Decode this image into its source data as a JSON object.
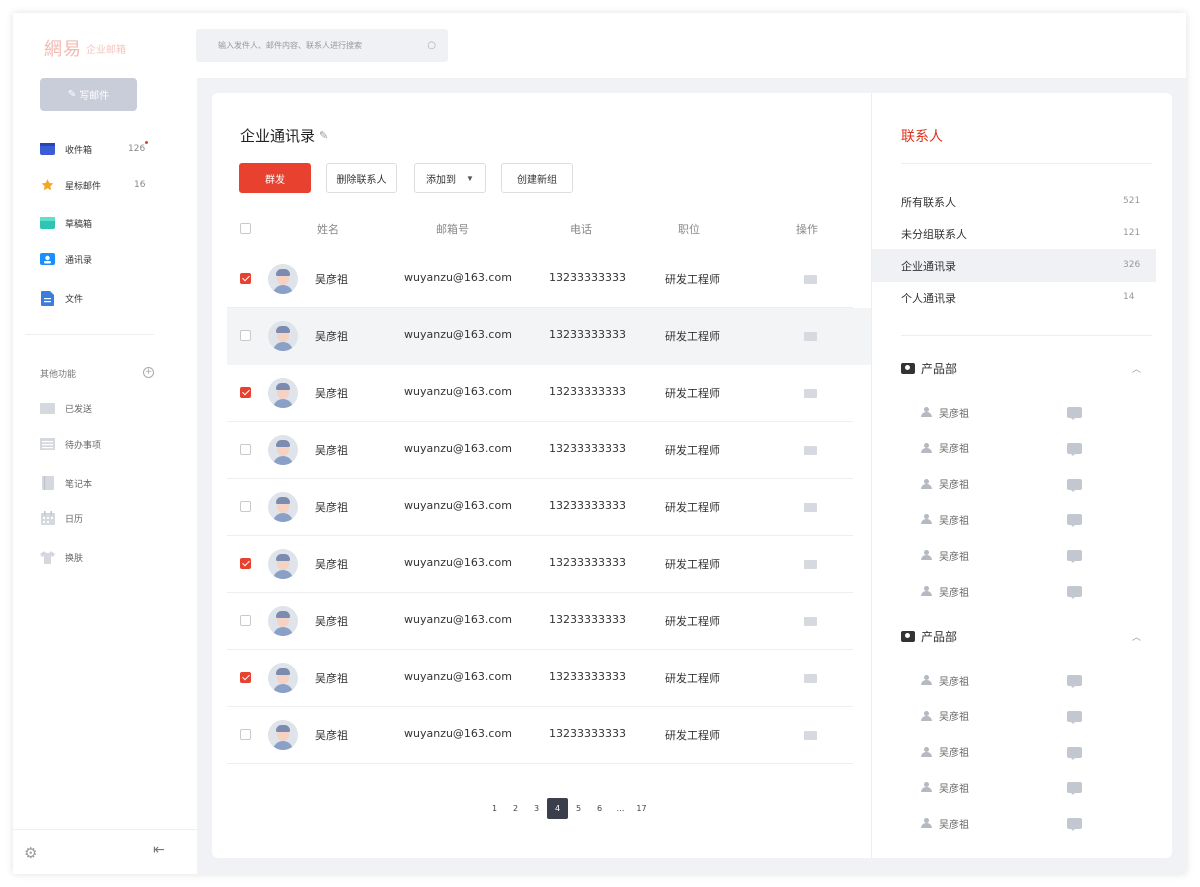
{
  "sidebar": {
    "logo_mark": "網易",
    "logo_text": "企业邮箱",
    "compose_label": "写邮件",
    "nav": [
      {
        "label": "收件箱",
        "count": "126",
        "icon": "inbox-icon",
        "color": "#3b5cd6"
      },
      {
        "label": "星标邮件",
        "count": "16",
        "icon": "star-icon",
        "color": "#f5a623"
      },
      {
        "label": "草稿箱",
        "count": "",
        "icon": "draft-icon",
        "color": "#2ec4b6"
      },
      {
        "label": "通讯录",
        "count": "",
        "icon": "contacts-icon",
        "color": "#1890ff"
      },
      {
        "label": "文件",
        "count": "",
        "icon": "file-icon",
        "color": "#3b7ddd"
      }
    ],
    "other_heading": "其他功能",
    "other": [
      {
        "label": "已发送",
        "icon": "sent-icon"
      },
      {
        "label": "待办事项",
        "icon": "todo-icon"
      },
      {
        "label": "笔记本",
        "icon": "notebook-icon"
      },
      {
        "label": "日历",
        "icon": "calendar-icon"
      },
      {
        "label": "换肤",
        "icon": "skin-icon"
      }
    ]
  },
  "search": {
    "placeholder": "输入发件人、邮件内容、联系人进行搜索"
  },
  "main": {
    "title": "企业通讯录",
    "buttons": {
      "mass_send": "群发",
      "delete": "删除联系人",
      "add_to": "添加到",
      "create_group": "创建新组"
    },
    "columns": [
      "姓名",
      "邮箱号",
      "电话",
      "职位",
      "操作"
    ],
    "rows": [
      {
        "name": "吴彦祖",
        "email": "wuyanzu@163.com",
        "phone": "13233333333",
        "title": "研发工程师",
        "checked": true
      },
      {
        "name": "吴彦祖",
        "email": "wuyanzu@163.com",
        "phone": "13233333333",
        "title": "研发工程师",
        "checked": false
      },
      {
        "name": "吴彦祖",
        "email": "wuyanzu@163.com",
        "phone": "13233333333",
        "title": "研发工程师",
        "checked": true
      },
      {
        "name": "吴彦祖",
        "email": "wuyanzu@163.com",
        "phone": "13233333333",
        "title": "研发工程师",
        "checked": false
      },
      {
        "name": "吴彦祖",
        "email": "wuyanzu@163.com",
        "phone": "13233333333",
        "title": "研发工程师",
        "checked": false
      },
      {
        "name": "吴彦祖",
        "email": "wuyanzu@163.com",
        "phone": "13233333333",
        "title": "研发工程师",
        "checked": true
      },
      {
        "name": "吴彦祖",
        "email": "wuyanzu@163.com",
        "phone": "13233333333",
        "title": "研发工程师",
        "checked": false
      },
      {
        "name": "吴彦祖",
        "email": "wuyanzu@163.com",
        "phone": "13233333333",
        "title": "研发工程师",
        "checked": true
      },
      {
        "name": "吴彦祖",
        "email": "wuyanzu@163.com",
        "phone": "13233333333",
        "title": "研发工程师",
        "checked": false
      }
    ],
    "pagination": {
      "pages": [
        "1",
        "2",
        "3",
        "4",
        "5",
        "6",
        "…",
        "17"
      ],
      "current": "4"
    }
  },
  "right": {
    "title": "联系人",
    "categories": [
      {
        "label": "所有联系人",
        "count": "521"
      },
      {
        "label": "未分组联系人",
        "count": "121"
      },
      {
        "label": "企业通讯录",
        "count": "326"
      },
      {
        "label": "个人通讯录",
        "count": "14"
      }
    ],
    "groups": [
      {
        "name": "产品部",
        "members": [
          "吴彦祖",
          "吴彦祖",
          "吴彦祖",
          "吴彦祖",
          "吴彦祖",
          "吴彦祖"
        ]
      },
      {
        "name": "产品部",
        "members": [
          "吴彦祖",
          "吴彦祖",
          "吴彦祖",
          "吴彦祖",
          "吴彦祖"
        ]
      }
    ]
  },
  "colors": {
    "accent": "#e8412f",
    "title_red": "#e0311c"
  }
}
